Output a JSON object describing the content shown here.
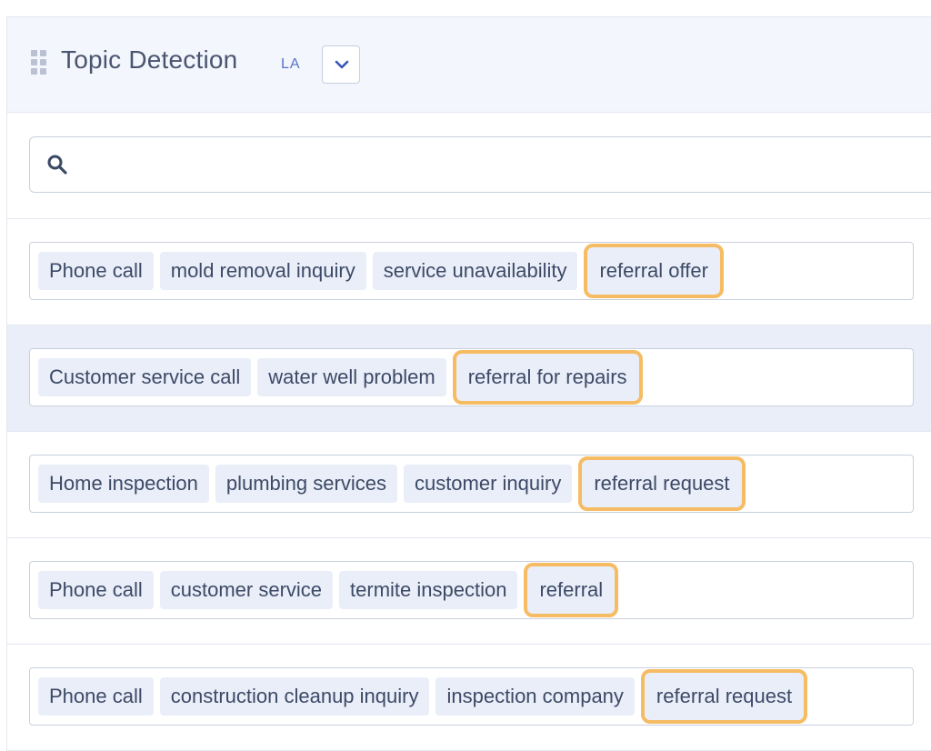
{
  "header": {
    "title": "Topic Detection",
    "badge": "LA"
  },
  "search": {
    "placeholder": "",
    "value": ""
  },
  "rows": [
    {
      "tags": [
        "Phone call",
        "mold removal inquiry",
        "service unavailability",
        "referral offer"
      ],
      "highlighted_tag": "referral offer"
    },
    {
      "tags": [
        "Customer service call",
        "water well problem",
        "referral for repairs"
      ],
      "highlighted_tag": "referral for repairs"
    },
    {
      "tags": [
        "Home inspection",
        "plumbing services",
        "customer inquiry",
        "referral request"
      ],
      "highlighted_tag": "referral request"
    },
    {
      "tags": [
        "Phone call",
        "customer service",
        "termite inspection",
        "referral"
      ],
      "highlighted_tag": "referral"
    },
    {
      "tags": [
        "Phone call",
        "construction cleanup inquiry",
        "inspection company",
        "referral request"
      ],
      "highlighted_tag": "referral request"
    }
  ],
  "icons": {
    "drag": "drag-handle-icon",
    "dropdown": "chevron-down-icon",
    "search": "search-icon"
  },
  "colors": {
    "header_bg": "#f3f6fc",
    "tag_bg": "#e9eef9",
    "highlight_border": "#f6bc63",
    "selected_row_bg": "#e9eef9",
    "accent": "#3a56b8"
  }
}
